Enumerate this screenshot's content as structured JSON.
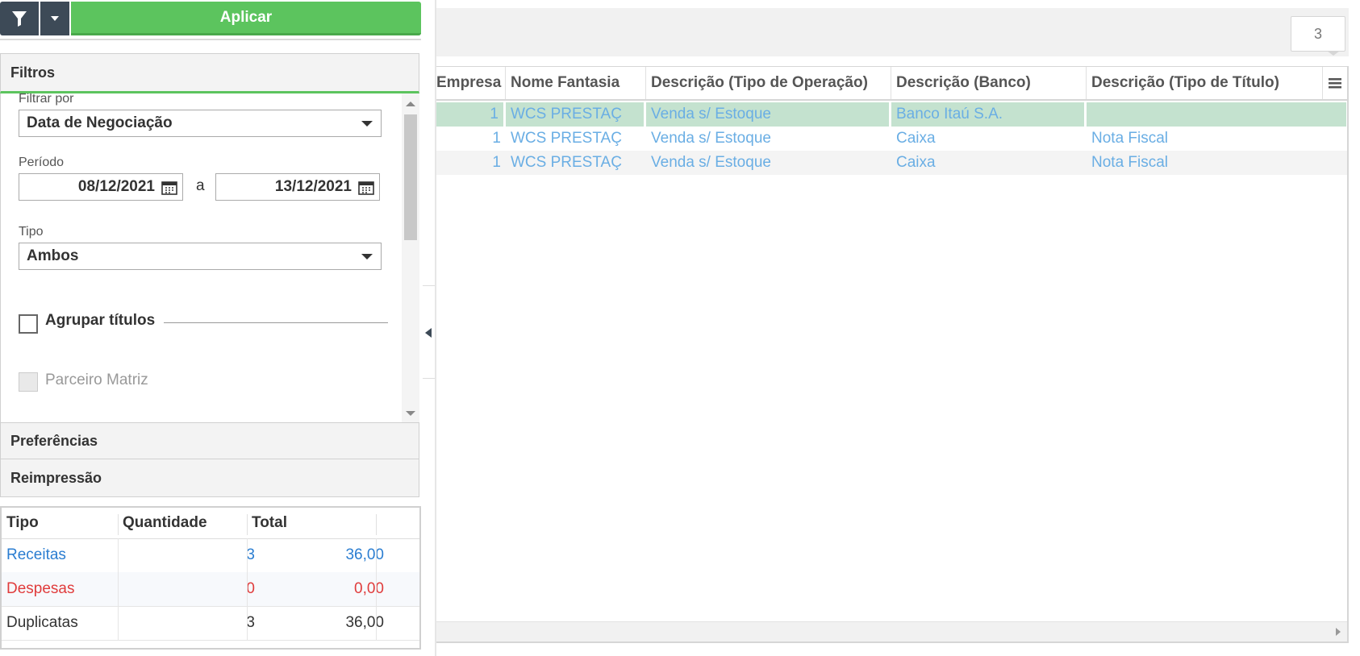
{
  "toolbar": {
    "apply_label": "Aplicar",
    "filter_icon": "filter-icon",
    "dropdown_icon": "caret-down-icon"
  },
  "accordion": {
    "filtros": "Filtros",
    "preferencias": "Preferências",
    "reimpressao": "Reimpressão"
  },
  "filters": {
    "filtrar_por_label": "Filtrar por",
    "filtrar_por_value": "Data de Negociação",
    "periodo_label": "Período",
    "date_from": "08/12/2021",
    "date_separator": "a",
    "date_to": "13/12/2021",
    "tipo_label": "Tipo",
    "tipo_value": "Ambos",
    "agrupar_label": "Agrupar títulos",
    "parceiro_label": "Parceiro Matriz"
  },
  "summary": {
    "headers": [
      "Tipo",
      "Quantidade",
      "Total"
    ],
    "rows": [
      {
        "tipo": "Receitas",
        "quantidade": "3",
        "total": "36,00",
        "color": "#2a7dd1"
      },
      {
        "tipo": "Despesas",
        "quantidade": "0",
        "total": "0,00",
        "color": "#e03c3c"
      },
      {
        "tipo": "Duplicatas",
        "quantidade": "3",
        "total": "36,00",
        "color": "#333333"
      }
    ]
  },
  "grid": {
    "record_count": "3",
    "columns": [
      "Empresa",
      "Nome Fantasia",
      "Descrição (Tipo de Operação)",
      "Descrição (Banco)",
      "Descrição (Tipo de Título)"
    ],
    "rows": [
      [
        "1",
        "WCS PRESTAÇ",
        "Venda s/ Estoque",
        "Banco Itaú S.A.",
        ""
      ],
      [
        "1",
        "WCS PRESTAÇ",
        "Venda s/ Estoque",
        "Caixa",
        "Nota Fiscal"
      ],
      [
        "1",
        "WCS PRESTAÇ",
        "Venda s/ Estoque",
        "Caixa",
        "Nota Fiscal"
      ]
    ]
  },
  "colors": {
    "apply_green": "#5cc45e",
    "toolbar_dark": "#3d4a57",
    "link_blue": "#6aaee4",
    "selected_row": "#c4e2cf"
  }
}
